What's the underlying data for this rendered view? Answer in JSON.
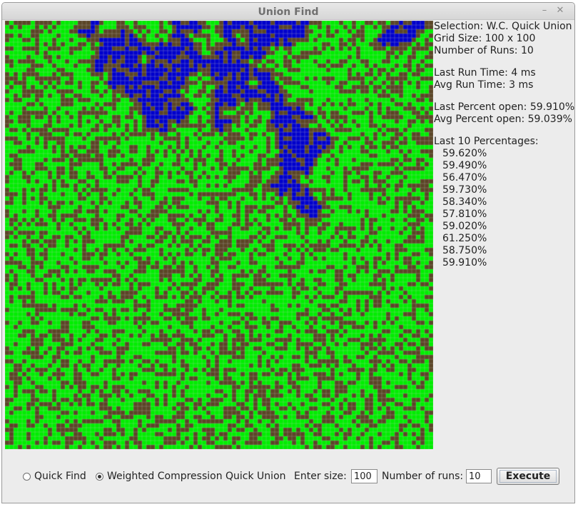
{
  "window": {
    "title": "Union Find",
    "minimize_glyph": "–",
    "close_glyph": "✕"
  },
  "grid": {
    "rows": 100,
    "cols": 100,
    "colors": {
      "open": "#00ee00",
      "blocked": "#5a4526",
      "full": "#0000cc",
      "line": "#c8c8c8"
    }
  },
  "stats": {
    "selection": "Selection: W.C. Quick Union",
    "grid_size": "Grid Size: 100 x 100",
    "num_runs": "Number of Runs: 10",
    "last_run_time": "Last Run Time: 4 ms",
    "avg_run_time": "Avg Run Time: 3 ms",
    "last_percent_open": "Last Percent open: 59.910%",
    "avg_percent_open": "Avg Percent open: 59.039%",
    "last_header": "Last 10 Percentages:",
    "percentages": [
      "59.620%",
      "59.490%",
      "56.470%",
      "59.730%",
      "58.340%",
      "57.810%",
      "59.020%",
      "61.250%",
      "58.750%",
      "59.910%"
    ]
  },
  "controls": {
    "quick_find_label": "Quick Find",
    "quick_find_selected": false,
    "wcqu_label": "Weighted Compression Quick Union",
    "wcqu_selected": true,
    "size_label": "Enter size:",
    "size_value": "100",
    "runs_label": "Number of runs:",
    "runs_value": "10",
    "execute_label": "Execute"
  }
}
